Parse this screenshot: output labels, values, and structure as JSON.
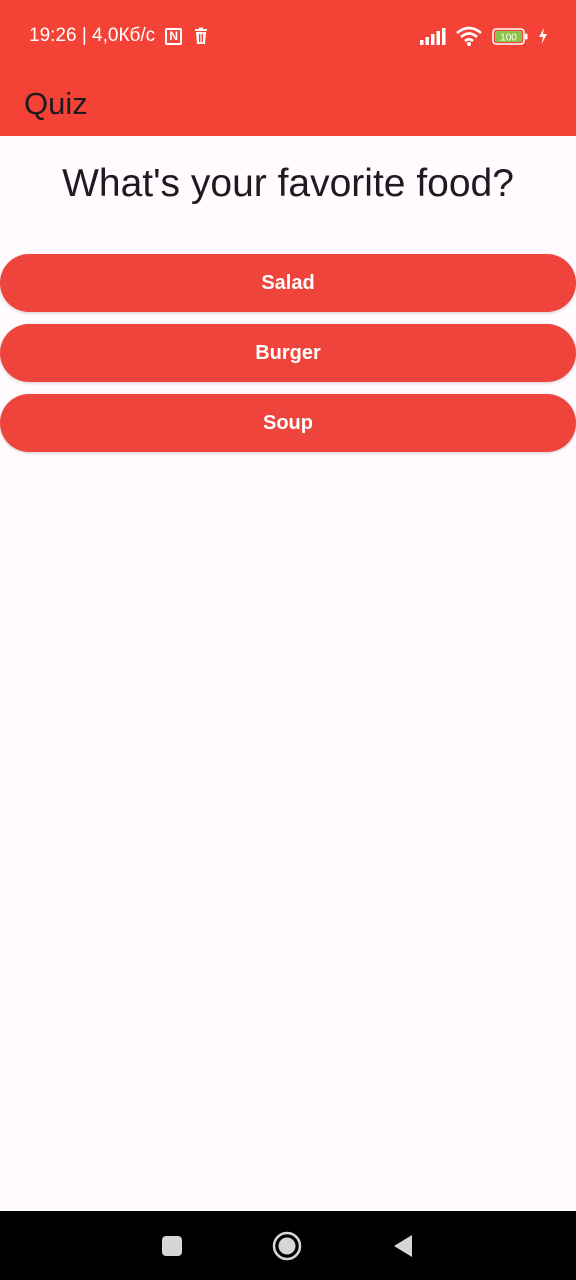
{
  "status_bar": {
    "time_speed": "19:26 | 4,0Кб/c",
    "nfc_glyph": "N",
    "battery_level": "100",
    "icons": [
      "nfc-icon",
      "trash-icon",
      "signal-icon",
      "wifi-icon",
      "battery-icon",
      "charging-bolt-icon"
    ]
  },
  "app_bar": {
    "title": "Quiz"
  },
  "quiz": {
    "question": "What's your favorite food?",
    "answers": [
      "Salad",
      "Burger",
      "Soup"
    ]
  },
  "nav_bar": {
    "icons": [
      "recent-apps-icon",
      "home-icon",
      "back-icon"
    ]
  },
  "colors": {
    "app_bar": "#f44336",
    "button": "#ee443c",
    "background": "#fffbfe",
    "battery_fill": "#8bc34a"
  }
}
